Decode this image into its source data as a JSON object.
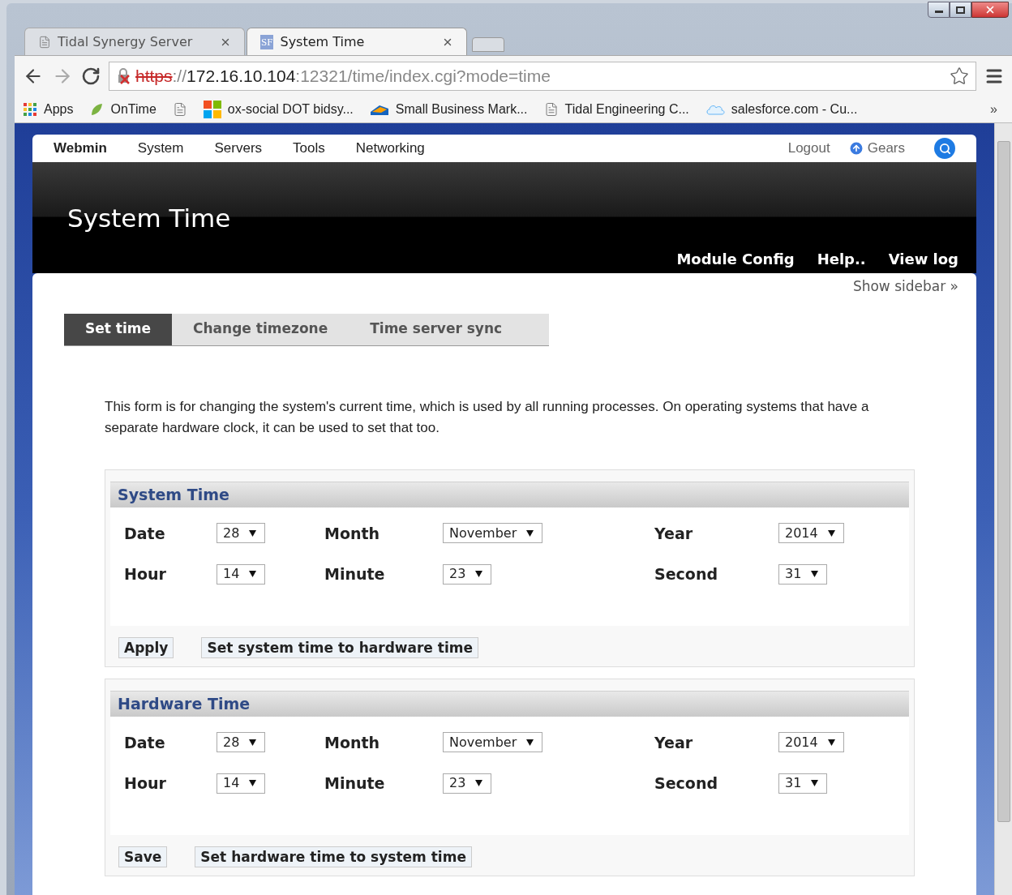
{
  "browser": {
    "tabs": [
      {
        "title": "Tidal Synergy Server",
        "selected": false,
        "kind": "page"
      },
      {
        "title": "System Time",
        "selected": true,
        "kind": "site"
      }
    ],
    "favicon_text": "SF",
    "address": {
      "secure": false,
      "scheme": "https",
      "separator": "://",
      "host": "172.16.10.104",
      "rest": ":12321/time/index.cgi?mode=time"
    },
    "bookmarks": [
      {
        "label": "Apps",
        "kind": "apps"
      },
      {
        "label": "OnTime",
        "kind": "leaf"
      },
      {
        "kind": "page"
      },
      {
        "label": "ox-social DOT bidsy...",
        "kind": "tiles"
      },
      {
        "label": "Small Business Mark...",
        "kind": "mark"
      },
      {
        "label": "Tidal Engineering C...",
        "kind": "page"
      },
      {
        "label": "salesforce.com - Cu...",
        "kind": "cloud"
      }
    ],
    "more": "»"
  },
  "webmin": {
    "nav": [
      {
        "label": "Webmin",
        "kind": "brand"
      },
      {
        "label": "System",
        "kind": "menu"
      },
      {
        "label": "Servers",
        "kind": "menu"
      },
      {
        "label": "Tools",
        "kind": "menu"
      },
      {
        "label": "Networking",
        "kind": "menu"
      }
    ],
    "logout": "Logout",
    "gears": "Gears",
    "title": "System Time",
    "links": [
      "Module Config",
      "Help..",
      "View log"
    ],
    "show_sidebar": "Show sidebar »"
  },
  "tabs": [
    {
      "label": "Set time",
      "selected": true
    },
    {
      "label": "Change timezone",
      "selected": false
    },
    {
      "label": "Time server sync",
      "selected": false
    }
  ],
  "description": "This form is for changing the system's current time, which is used by all running processes. On operating systems that have a separate hardware clock, it can be used to set that too.",
  "sections": [
    {
      "title": "System Time",
      "fields": [
        {
          "label": "Date",
          "value": "28"
        },
        {
          "label": "Month",
          "value": "November"
        },
        {
          "label": "Year",
          "value": "2014"
        },
        {
          "label": "Hour",
          "value": "14"
        },
        {
          "label": "Minute",
          "value": "23"
        },
        {
          "label": "Second",
          "value": "31"
        }
      ],
      "buttons": [
        "Apply",
        "Set system time to hardware time"
      ]
    },
    {
      "title": "Hardware Time",
      "fields": [
        {
          "label": "Date",
          "value": "28"
        },
        {
          "label": "Month",
          "value": "November"
        },
        {
          "label": "Year",
          "value": "2014"
        },
        {
          "label": "Hour",
          "value": "14"
        },
        {
          "label": "Minute",
          "value": "23"
        },
        {
          "label": "Second",
          "value": "31"
        }
      ],
      "buttons": [
        "Save",
        "Set hardware time to system time"
      ]
    }
  ]
}
